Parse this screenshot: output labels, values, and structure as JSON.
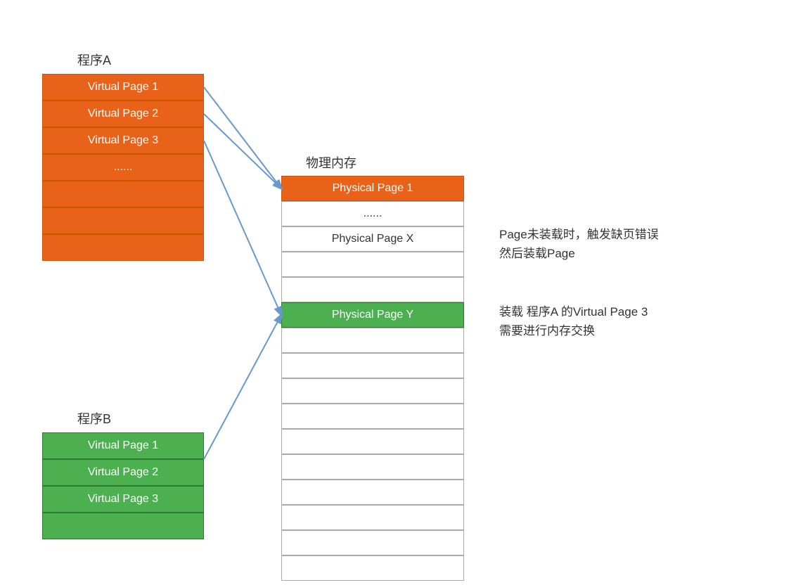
{
  "progA": {
    "label": "程序A",
    "pages": [
      {
        "text": "Virtual Page 1",
        "type": "orange"
      },
      {
        "text": "Virtual Page 2",
        "type": "orange"
      },
      {
        "text": "Virtual Page 3",
        "type": "orange"
      },
      {
        "text": "......",
        "type": "orange"
      },
      {
        "text": "",
        "type": "orange"
      },
      {
        "text": "",
        "type": "orange"
      },
      {
        "text": "",
        "type": "orange"
      }
    ]
  },
  "progB": {
    "label": "程序B",
    "pages": [
      {
        "text": "Virtual Page 1",
        "type": "green"
      },
      {
        "text": "Virtual Page 2",
        "type": "green"
      },
      {
        "text": "Virtual Page 3",
        "type": "green"
      },
      {
        "text": "",
        "type": "green"
      }
    ]
  },
  "physMem": {
    "label": "物理内存",
    "pages": [
      {
        "text": "Physical Page 1",
        "type": "orange"
      },
      {
        "text": "......",
        "type": "plain"
      },
      {
        "text": "Physical Page X",
        "type": "plain"
      },
      {
        "text": "",
        "type": "plain"
      },
      {
        "text": "",
        "type": "plain"
      },
      {
        "text": "Physical Page Y",
        "type": "green"
      },
      {
        "text": "",
        "type": "plain"
      },
      {
        "text": "",
        "type": "plain"
      },
      {
        "text": "",
        "type": "plain"
      },
      {
        "text": "",
        "type": "plain"
      },
      {
        "text": "",
        "type": "plain"
      },
      {
        "text": "",
        "type": "plain"
      },
      {
        "text": "",
        "type": "plain"
      },
      {
        "text": "",
        "type": "plain"
      },
      {
        "text": "",
        "type": "plain"
      },
      {
        "text": "",
        "type": "plain"
      }
    ]
  },
  "annotations": {
    "text1_line1": "Page未装载时，触发缺页错误",
    "text1_line2": "然后装载Page",
    "text2_line1": "装载 程序A 的Virtual Page 3",
    "text2_line2": "需要进行内存交换"
  }
}
